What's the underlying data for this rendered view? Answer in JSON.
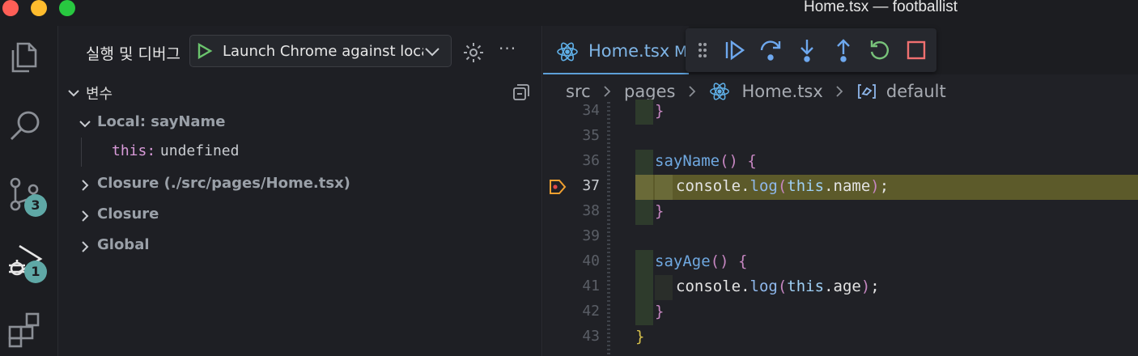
{
  "window": {
    "title": "Home.tsx — footballist"
  },
  "activity_bar": {
    "scm_badge": "3",
    "debug_badge": "1"
  },
  "side_panel": {
    "title": "실행 및 디버그",
    "launch_config": "Launch Chrome against localhost",
    "more_label": "···",
    "variables_section": "변수",
    "scopes": [
      {
        "label": "Local: sayName",
        "expanded": true
      },
      {
        "label": "Closure (./src/pages/Home.tsx)",
        "expanded": false
      },
      {
        "label": "Closure",
        "expanded": false
      },
      {
        "label": "Global",
        "expanded": false
      }
    ],
    "local_var": {
      "key": "this:",
      "value": "undefined"
    }
  },
  "editor": {
    "tab": {
      "label": "Home.tsx",
      "modified": "M"
    },
    "breadcrumb": [
      "src",
      "pages",
      "Home.tsx",
      "default"
    ],
    "lines": [
      {
        "num": "34",
        "text": "}"
      },
      {
        "num": "35",
        "text": ""
      },
      {
        "num": "36",
        "text": "sayName() {"
      },
      {
        "num": "37",
        "text": "console.log(this.name);"
      },
      {
        "num": "38",
        "text": "}"
      },
      {
        "num": "39",
        "text": ""
      },
      {
        "num": "40",
        "text": "sayAge() {"
      },
      {
        "num": "41",
        "text": "console.log(this.age);"
      },
      {
        "num": "42",
        "text": "}"
      },
      {
        "num": "43",
        "text": "}"
      }
    ],
    "active_line": "37"
  },
  "colors": {
    "accent": "#5d9fd8",
    "highlight_line": "#5c5a2a",
    "breakpoint": "#f0a030",
    "badge": "#5fa8a6"
  }
}
